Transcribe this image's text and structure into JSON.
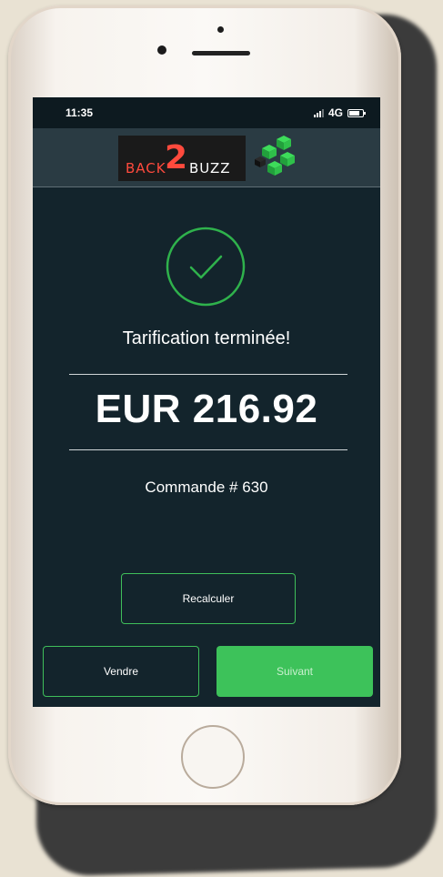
{
  "status_bar": {
    "time": "11:35",
    "network": "4G"
  },
  "brand": {
    "back": "BACK",
    "two": "2",
    "buzz": "BUZZ"
  },
  "result": {
    "title": "Tarification terminée!",
    "amount": "EUR 216.92",
    "order": "Commande # 630"
  },
  "buttons": {
    "recalculate": "Recalculer",
    "sell": "Vendre",
    "next": "Suivant"
  },
  "colors": {
    "screen_background": "#13242c",
    "accent_green": "#3dc25a",
    "logo_red": "#ff4a3d"
  },
  "icons": [
    "check-circle-icon",
    "signal-icon",
    "battery-icon",
    "cube-logo-icon"
  ]
}
